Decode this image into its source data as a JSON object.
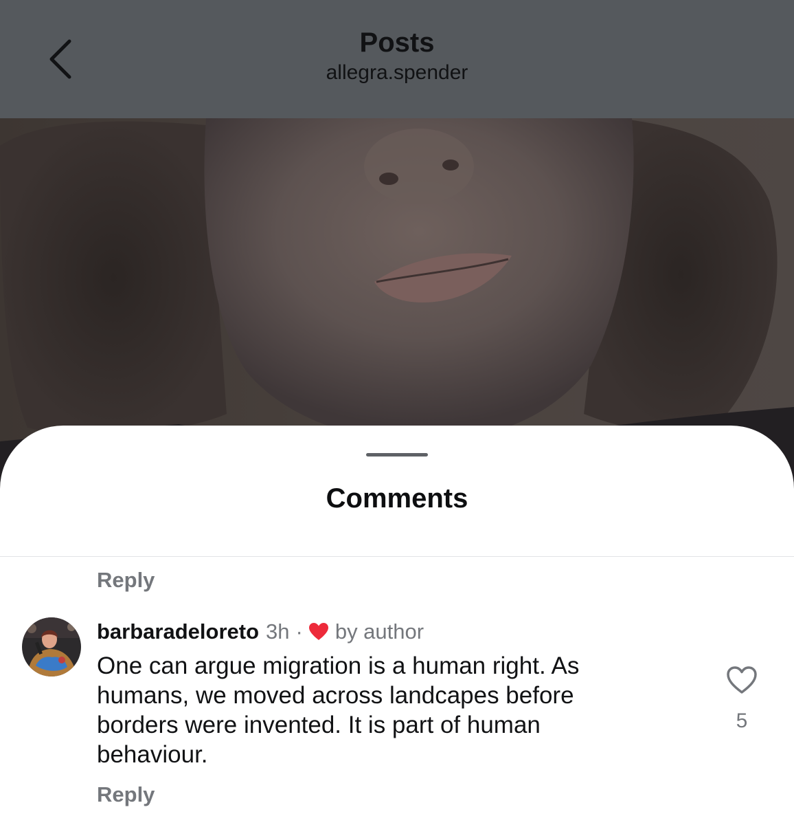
{
  "header": {
    "title": "Posts",
    "subtitle": "allegra.spender",
    "back_icon": "chevron-left-icon",
    "background_color": "#55595d"
  },
  "comments_sheet": {
    "title": "Comments",
    "reply_label_top": "Reply",
    "reply_label_bottom": "Reply"
  },
  "comment": {
    "username": "barbaradeloreto",
    "timestamp": "3h",
    "separator": "·",
    "liked_by_author_label": "by author",
    "liked_by_author_icon": "heart-filled-icon",
    "liked_by_author_color": "#ed2a3a",
    "text": "One can argue migration is a human right. As humans, we moved across landcapes before borders were invented. It is part of human behaviour.",
    "like_icon": "heart-outline-icon",
    "like_count": "5"
  }
}
